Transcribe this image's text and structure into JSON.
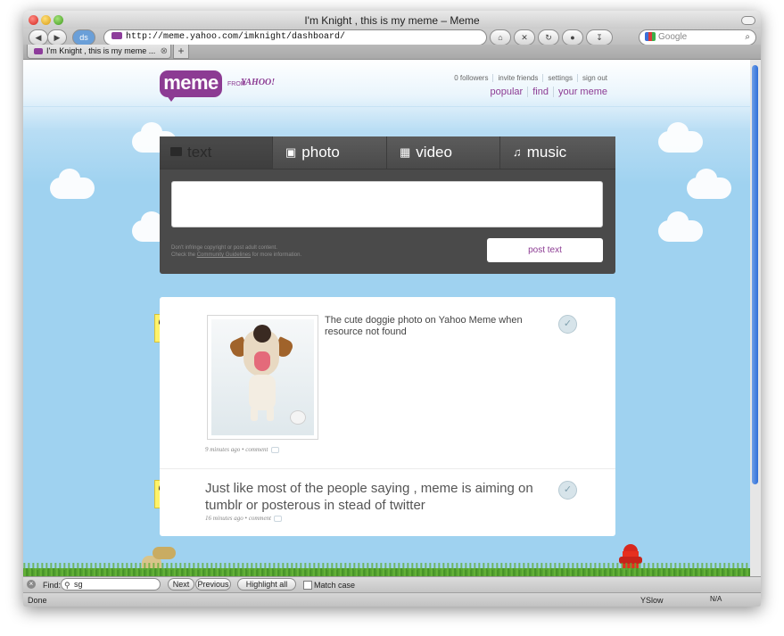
{
  "browser": {
    "window_title": "I'm Knight , this is my meme – Meme",
    "url": "http://meme.yahoo.com/imknight/dashboard/",
    "search_placeholder": "Google",
    "tab_title": "I'm Knight , this is my meme ...",
    "status_text": "Done",
    "yslow_label": "YSlow",
    "na_label": "N/A"
  },
  "findbar": {
    "label": "Find:",
    "query": "sg",
    "next_label": "Next",
    "previous_label": "Previous",
    "highlight_label": "Highlight all",
    "match_case_label": "Match case"
  },
  "site": {
    "logo_text": "meme",
    "from_text": "FROM",
    "yahoo_text": "YAHOO!",
    "top_links": [
      "0 followers",
      "invite friends",
      "settings",
      "sign out"
    ],
    "main_links": [
      "popular",
      "find",
      "your meme"
    ]
  },
  "composer": {
    "tabs": [
      {
        "label": "text",
        "icon": "speech-bubble-icon"
      },
      {
        "label": "photo",
        "icon": "camera-icon"
      },
      {
        "label": "video",
        "icon": "film-icon"
      },
      {
        "label": "music",
        "icon": "music-note-icon"
      }
    ],
    "active_tab": "text",
    "disclaimer_line1": "Don't infringe copyright or post adult content.",
    "disclaimer_check": "Check the",
    "disclaimer_link": "Community Guidelines",
    "disclaimer_tail": "for more information.",
    "post_button": "post text"
  },
  "posts": [
    {
      "text": "The cute doggie photo on Yahoo Meme when resource not found",
      "time": "9 minutes ago",
      "comment_label": "comment",
      "has_photo": true
    },
    {
      "text": "Just like most of the people saying , meme is aiming on tumblr or posterous in stead of twitter",
      "time": "16 minutes ago",
      "comment_label": "comment",
      "has_photo": false
    }
  ],
  "colors": {
    "brand": "#8c3b93",
    "sky": "#9fd2f0",
    "composer_bg": "#4a4a4a"
  }
}
